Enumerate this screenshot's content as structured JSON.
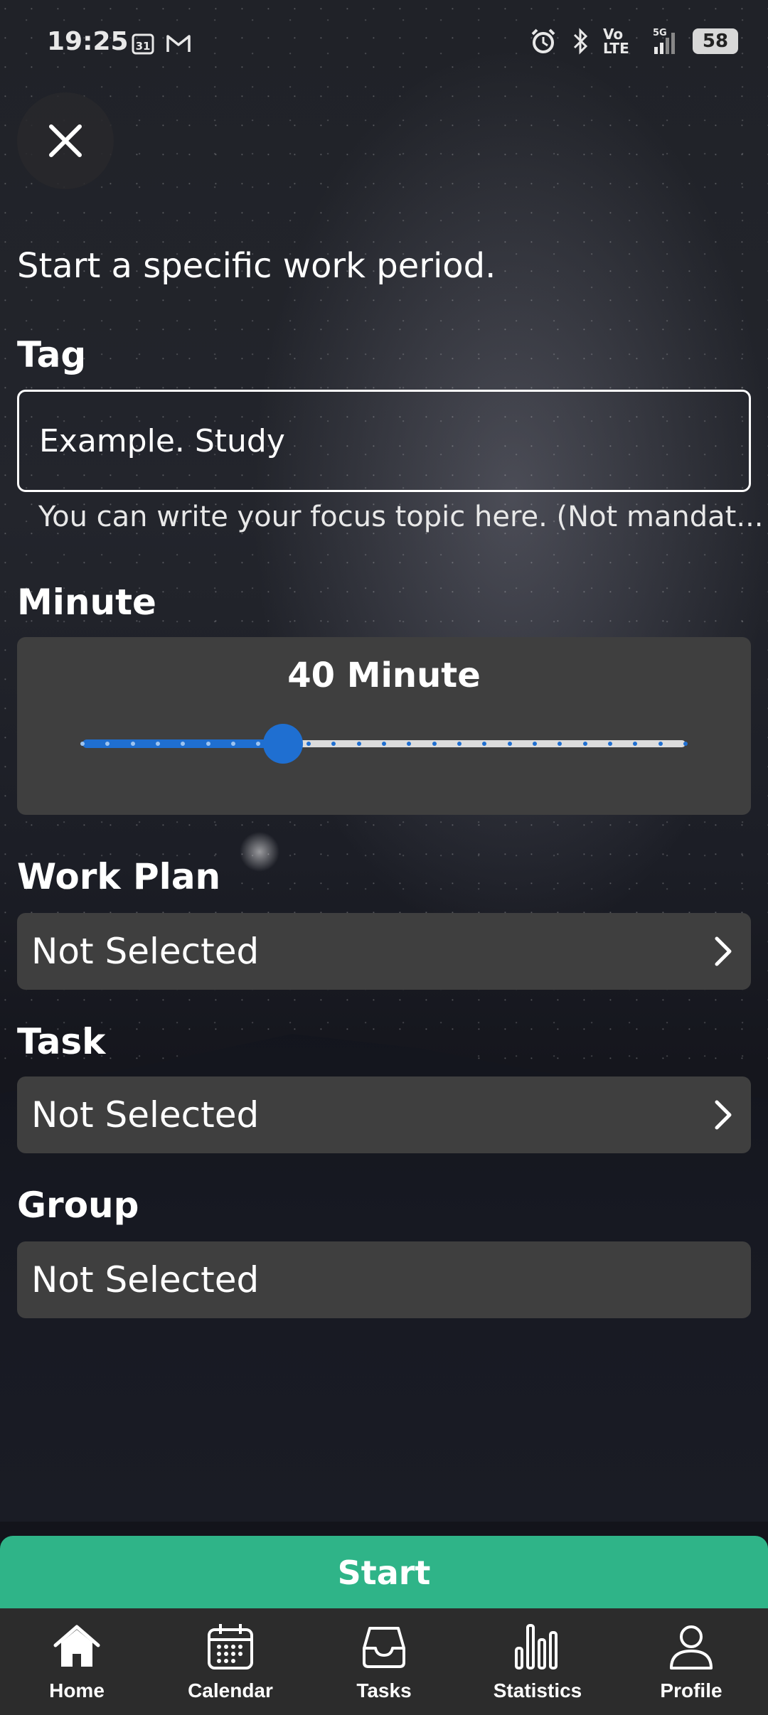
{
  "status_bar": {
    "time": "19:25",
    "calendar_badge": "31",
    "network_label": "Vo LTE",
    "network_type": "5G",
    "battery": "58"
  },
  "intro_text": "Start a specific work period.",
  "tag": {
    "label": "Tag",
    "placeholder": "Example. Study",
    "value": "",
    "helper": "You can write your focus topic here. (Not mandat..."
  },
  "minute": {
    "label": "Minute",
    "display": "40 Minute",
    "slider_fraction": 0.333,
    "slider_divisions": 24,
    "accent": "#1f6fd1"
  },
  "work_plan": {
    "label": "Work Plan",
    "value": "Not Selected"
  },
  "task": {
    "label": "Task",
    "value": "Not Selected"
  },
  "group": {
    "label": "Group",
    "value": "Not Selected"
  },
  "start_button": {
    "label": "Start",
    "color": "#2fb488"
  },
  "bottom_nav": {
    "items": [
      {
        "label": "Home",
        "icon": "home-icon",
        "active": true
      },
      {
        "label": "Calendar",
        "icon": "calendar-icon"
      },
      {
        "label": "Tasks",
        "icon": "tray-icon"
      },
      {
        "label": "Statistics",
        "icon": "bar-chart-icon"
      },
      {
        "label": "Profile",
        "icon": "person-icon"
      }
    ]
  }
}
